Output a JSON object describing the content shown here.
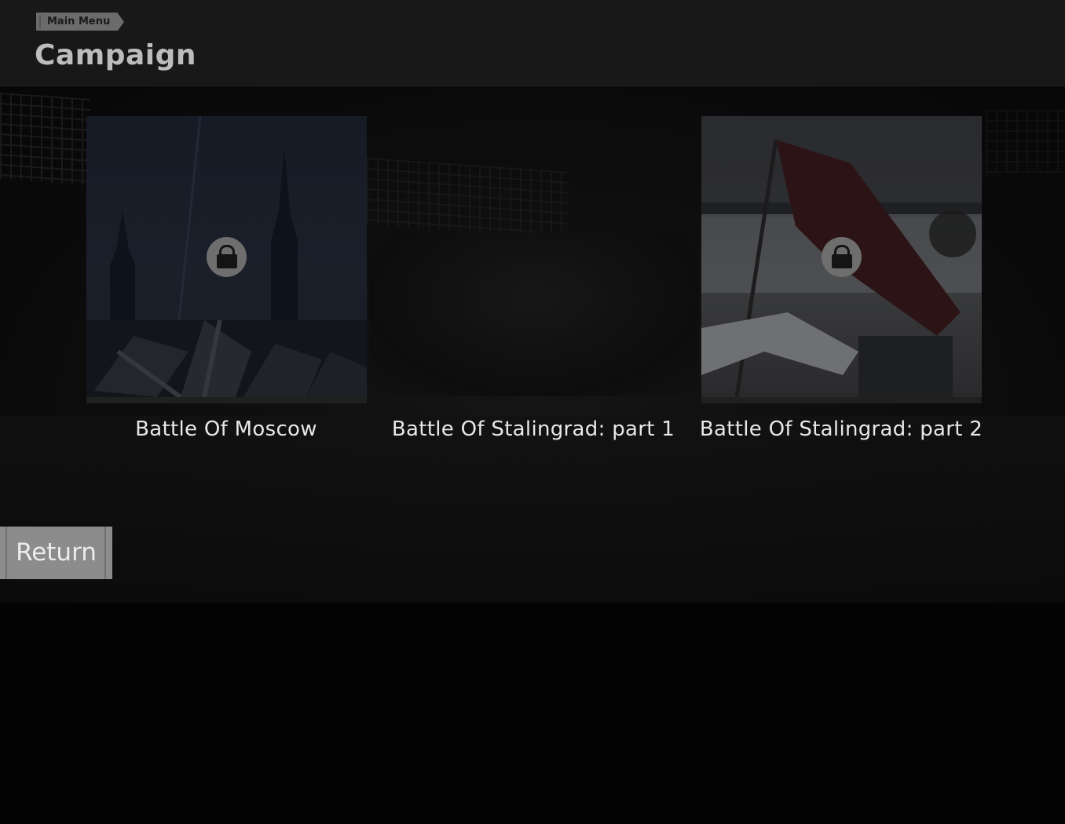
{
  "header": {
    "breadcrumb": "Main Menu",
    "title": "Campaign"
  },
  "campaigns": [
    {
      "label": "Battle Of Moscow",
      "locked": true,
      "icon": "lock-icon"
    },
    {
      "label": "Battle Of Stalingrad: part 1",
      "locked": false
    },
    {
      "label": "Battle Of Stalingrad: part 2",
      "locked": true,
      "icon": "lock-icon"
    }
  ],
  "footer": {
    "return_label": "Return"
  },
  "colors": {
    "background": "#030303",
    "header": "#181818",
    "button": "#8c8c8c",
    "text": "#e8e8e8"
  }
}
